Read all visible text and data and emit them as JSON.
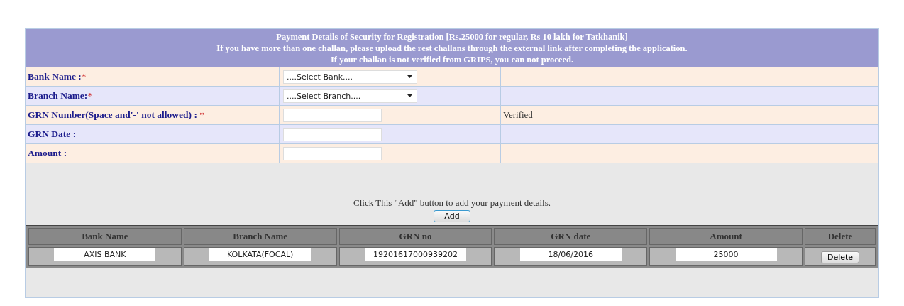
{
  "header": {
    "lines": [
      "Payment Details of Security for Registration [Rs.25000 for regular, Rs 10 lakh for Tatkhanik]",
      "If you have more than one challan, please upload the rest challans through the external link after completing the application.",
      "If your challan is not verified from GRIPS, you can not proceed."
    ]
  },
  "fields": [
    {
      "label": "Bank Name :",
      "required_mark": "*",
      "kind": "select",
      "value": "....Select Bank...."
    },
    {
      "label": "Branch Name:",
      "required_mark": "*",
      "kind": "select",
      "value": "....Select Branch...."
    },
    {
      "label": "GRN Number(Space and'-' not allowed) : ",
      "required_mark": "*",
      "kind": "text",
      "status": "Verified"
    },
    {
      "label": "GRN Date :",
      "kind": "text"
    },
    {
      "label": "Amount :",
      "kind": "text"
    }
  ],
  "add_hint": "Click This \"Add\" button to add your payment details.",
  "add_button": "Add",
  "table": {
    "columns": [
      "Bank Name",
      "Branch Name",
      "GRN no",
      "GRN date",
      "Amount",
      "Delete"
    ],
    "rows": [
      {
        "cells": [
          "AXIS BANK",
          "KOLKATA(FOCAL)",
          "19201617000939202",
          "18/06/2016",
          "25000"
        ],
        "action": "Delete"
      }
    ]
  }
}
